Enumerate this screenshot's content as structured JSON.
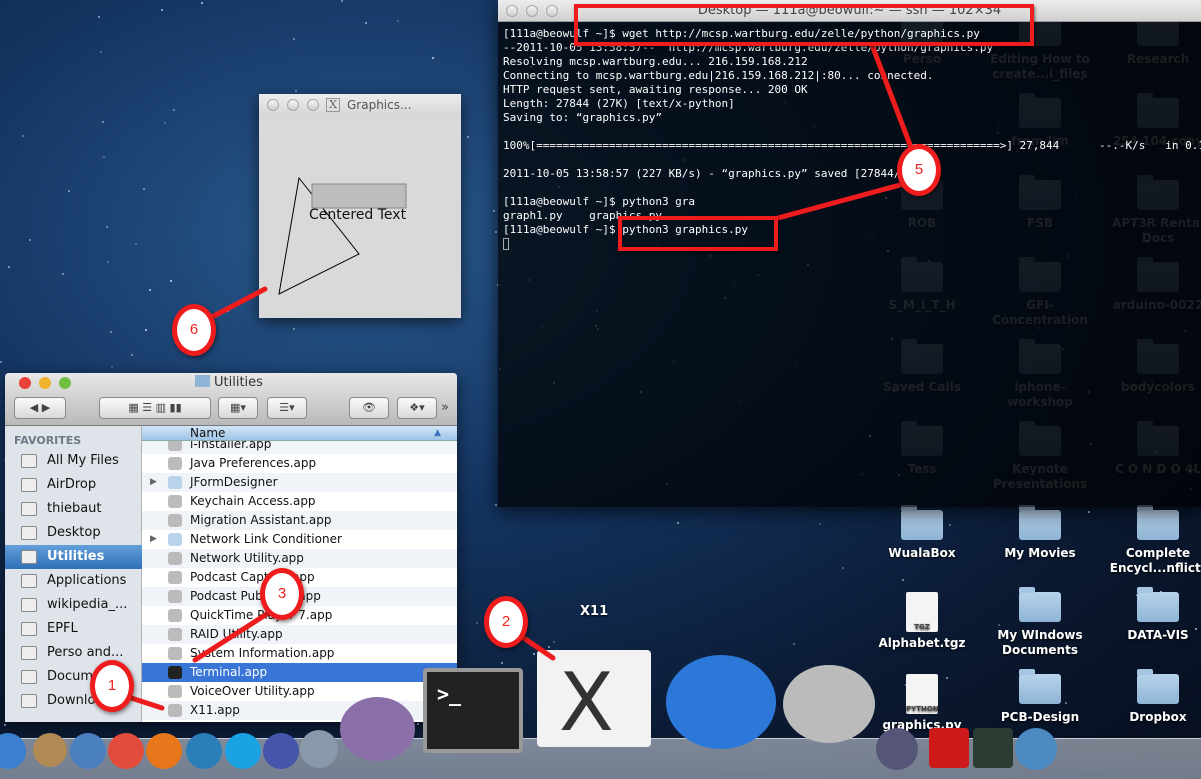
{
  "desktop": {
    "icons_behind_terminal": [
      {
        "label": "Perso"
      },
      {
        "label": "Editing How to create...i_files"
      },
      {
        "label": "Research"
      },
      {
        "label": "from Jim"
      },
      {
        "label": "254 104 copy"
      },
      {
        "label": "ROB"
      },
      {
        "label": "FSB"
      },
      {
        "label": "APT3R Rental Docs"
      },
      {
        "label": "S_M_I_T_H"
      },
      {
        "label": "GFI-Concentration"
      },
      {
        "label": "arduino-0022"
      },
      {
        "label": "Saved Calls"
      },
      {
        "label": "iphone-workshop"
      },
      {
        "label": "bodycolors"
      },
      {
        "label": "Tess"
      },
      {
        "label": "Keynote Presentations"
      },
      {
        "label": "C O N D O  4L"
      }
    ],
    "icons": [
      {
        "label": "WualaBox"
      },
      {
        "label": "My Movies"
      },
      {
        "label": "Complete Encycl...nflict)"
      },
      {
        "label": "Alphabet.tgz",
        "badge": "TGZ"
      },
      {
        "label": "My WIndows Documents"
      },
      {
        "label": "DATA-VIS"
      },
      {
        "label": "graphics.py",
        "badge": "PYTHON"
      },
      {
        "label": "PCB-Design"
      },
      {
        "label": "Dropbox"
      }
    ]
  },
  "terminal": {
    "title": "Desktop — 111a@beowulf:~ — ssh — 102×34",
    "lines": [
      "[111a@beowulf ~]$ wget http://mcsp.wartburg.edu/zelle/python/graphics.py",
      "--2011-10-05 13:58:57--  http://mcsp.wartburg.edu/zelle/python/graphics.py",
      "Resolving mcsp.wartburg.edu... 216.159.168.212",
      "Connecting to mcsp.wartburg.edu|216.159.168.212|:80... connected.",
      "HTTP request sent, awaiting response... 200 OK",
      "Length: 27844 (27K) [text/x-python]",
      "Saving to: “graphics.py”",
      "",
      "100%[======================================================================>] 27,844      --.-K/s   in 0.1s",
      "",
      "2011-10-05 13:58:57 (227 KB/s) - “graphics.py” saved [27844/27844]",
      "",
      "[111a@beowulf ~]$ python3 gra",
      "graph1.py    graphics.py",
      "[111a@beowulf ~]$ python3 graphics.py"
    ]
  },
  "graphics_window": {
    "title": "Graphics...",
    "text": "Centered Text"
  },
  "finder": {
    "title": "Utilities",
    "sidebar_header": "FAVORITES",
    "sidebar": [
      "All My Files",
      "AirDrop",
      "thiebaut",
      "Desktop",
      "Utilities",
      "Applications",
      "wikipedia_...",
      "EPFL",
      "Perso and...",
      "Documents",
      "Downloads"
    ],
    "selected_sidebar": "Utilities",
    "column_header": "Name",
    "rows": [
      {
        "name": "i-Installer.app"
      },
      {
        "name": "Java Preferences.app"
      },
      {
        "name": "JFormDesigner",
        "folder": true
      },
      {
        "name": "Keychain Access.app"
      },
      {
        "name": "Migration Assistant.app"
      },
      {
        "name": "Network Link Conditioner",
        "folder": true
      },
      {
        "name": "Network Utility.app"
      },
      {
        "name": "Podcast Capture.app"
      },
      {
        "name": "Podcast Publisher.app"
      },
      {
        "name": "QuickTime Player 7.app"
      },
      {
        "name": "RAID Utility.app"
      },
      {
        "name": "System Information.app"
      },
      {
        "name": "Terminal.app",
        "selected": true
      },
      {
        "name": "VoiceOver Utility.app"
      },
      {
        "name": "X11.app"
      }
    ]
  },
  "dock": {
    "hover_label": "X11",
    "apps": [
      "iTunes",
      "Mail",
      "Thunderbird",
      "Chrome",
      "Firefox",
      "Sound app",
      "Skype",
      "Eclipse",
      "Preview",
      "iMovie",
      "Terminal",
      "X11",
      "QuickTime",
      "Software Update",
      "FaceTime",
      "Acrobat",
      "Activity Monitor",
      "Xcode"
    ]
  },
  "annotations": [
    "1",
    "2",
    "3",
    "5",
    "6"
  ],
  "colors": {
    "annotation": "#ee1c1c",
    "selection": "#3875d7"
  }
}
